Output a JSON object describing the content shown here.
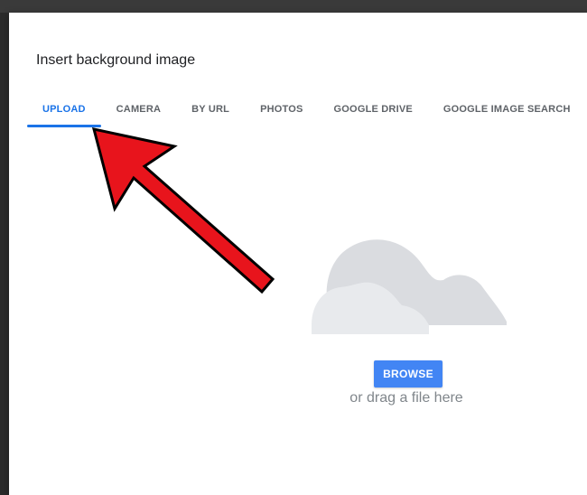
{
  "dialog": {
    "title": "Insert background image"
  },
  "tabs": [
    {
      "label": "UPLOAD",
      "active": true
    },
    {
      "label": "CAMERA",
      "active": false
    },
    {
      "label": "BY URL",
      "active": false
    },
    {
      "label": "PHOTOS",
      "active": false
    },
    {
      "label": "GOOGLE DRIVE",
      "active": false
    },
    {
      "label": "GOOGLE IMAGE SEARCH",
      "active": false
    }
  ],
  "upload": {
    "icon": "cloud-icon",
    "browse_label": "BROWSE",
    "drag_text": "or drag a file here"
  },
  "annotation": {
    "icon": "red-arrow-icon",
    "color": "#e8141c"
  },
  "colors": {
    "accent": "#1a73e8",
    "button": "#4285f4",
    "tab_inactive": "#5f6368",
    "cloud_back": "#dadce0",
    "cloud_front": "#e8eaed"
  }
}
